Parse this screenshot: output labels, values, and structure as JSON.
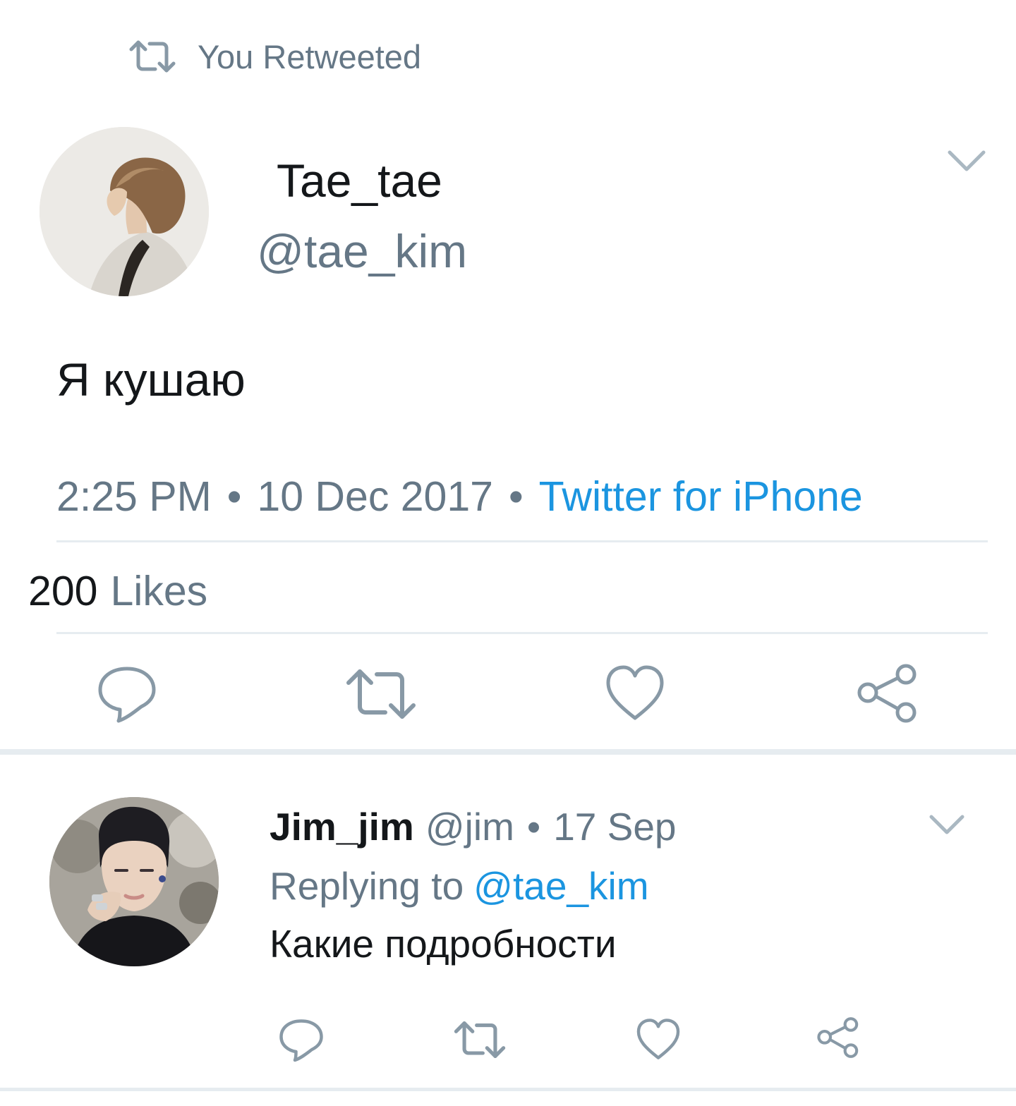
{
  "retweet_context": {
    "icon": "retweet-icon",
    "label": "You Retweeted"
  },
  "main_tweet": {
    "avatar_icon": "profile-photo",
    "display_name": "Tae_tae",
    "handle": "@tae_kim",
    "text": "Я кушаю",
    "time": "2:25 PM",
    "separator": "•",
    "date": "10 Dec 2017",
    "source": "Twitter for iPhone",
    "likes_count": "200",
    "likes_label": "Likes",
    "actions": [
      "reply-icon",
      "retweet-icon",
      "like-icon",
      "share-icon"
    ]
  },
  "reply_tweet": {
    "avatar_icon": "profile-photo",
    "display_name": "Jim_jim",
    "handle": "@jim",
    "separator": "•",
    "date": "17 Sep",
    "replying_prefix": "Replying to",
    "replying_handle": "@tae_kim",
    "text": "Какие подробности",
    "actions": [
      "reply-icon",
      "retweet-icon",
      "like-icon",
      "share-icon"
    ]
  },
  "colors": {
    "text_primary": "#14171a",
    "text_secondary": "#657786",
    "link": "#1b95e0",
    "icon": "#8899a6",
    "divider": "#e6ecf0"
  }
}
